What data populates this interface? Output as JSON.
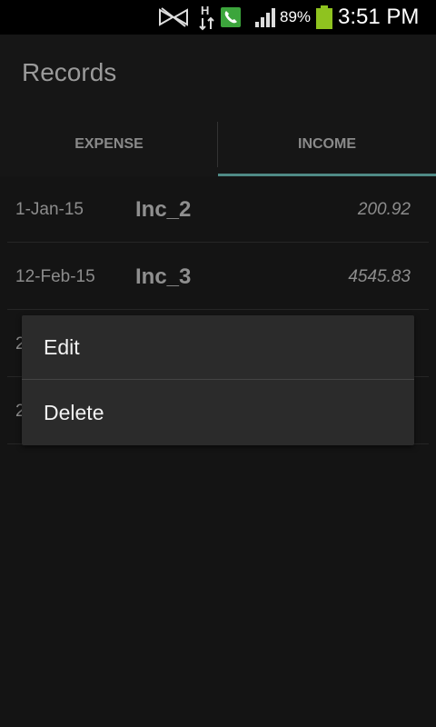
{
  "status_bar": {
    "battery_percent": "89%",
    "time": "3:51 PM",
    "icons": [
      "mute-icon",
      "hspa-icon",
      "phone-call-icon",
      "signal-icon",
      "battery-icon"
    ],
    "colors": {
      "phone_green": "#3ca53c",
      "battery_green": "#8fc31f"
    }
  },
  "app": {
    "title": "Records"
  },
  "tabs": [
    {
      "label": "EXPENSE",
      "selected": false
    },
    {
      "label": "INCOME",
      "selected": true
    }
  ],
  "tab_indicator_color": "#4f8a86",
  "records": [
    {
      "date": "1-Jan-15",
      "name": "Inc_2",
      "amount": "200.92"
    },
    {
      "date": "12-Feb-15",
      "name": "Inc_3",
      "amount": "4545.83"
    },
    {
      "date": "2",
      "name": "",
      "amount": ""
    },
    {
      "date": "2",
      "name": "",
      "amount": ""
    }
  ],
  "context_menu": {
    "items": [
      {
        "label": "Edit"
      },
      {
        "label": "Delete"
      }
    ]
  }
}
